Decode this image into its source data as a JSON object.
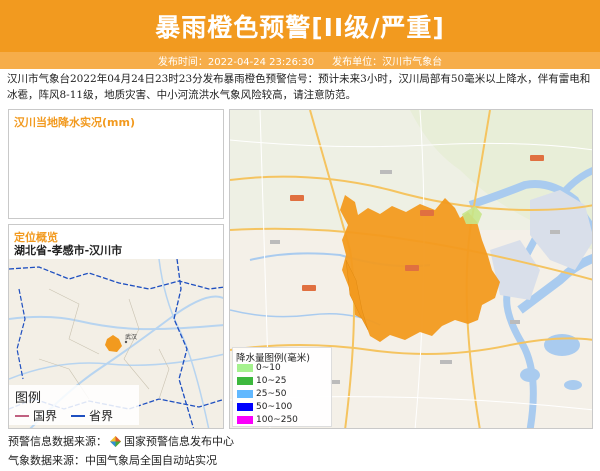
{
  "header": {
    "title": "暴雨橙色预警[II级/严重]",
    "publish_time_label": "发布时间：2022-04-24 23:26:30",
    "publisher_label": "发布单位：汉川市气象台"
  },
  "description": "汉川市气象台2022年04月24日23时23分发布暴雨橙色预警信号：预计未来3小时，汉川局部有50毫米以上降水，伴有雷电和冰雹，阵风8-11级，地质灾害、中小河流洪水气象风险较高，请注意防范。",
  "rain_panel": {
    "title": "汉川当地降水实况(mm)"
  },
  "location_panel": {
    "title": "定位概览",
    "subtitle": "湖北省-孝感市-汉川市",
    "city_label": "武汉",
    "legend": {
      "title": "图例",
      "items": [
        {
          "label": "国界",
          "color": "#c06080"
        },
        {
          "label": "省界",
          "color": "#1e4fc0"
        }
      ]
    }
  },
  "main_map": {
    "warning_area_color": "#f29a1f",
    "legend": {
      "title": "降水量图例(毫米)",
      "items": [
        {
          "label": "0~10",
          "color": "#a6f28f"
        },
        {
          "label": "10~25",
          "color": "#3db83d"
        },
        {
          "label": "25~50",
          "color": "#61b8ff"
        },
        {
          "label": "50~100",
          "color": "#0000fe"
        },
        {
          "label": "100~250",
          "color": "#fa00fa"
        }
      ]
    }
  },
  "footer": {
    "warning_source": "预警信息数据来源：",
    "warning_source_name": "国家预警信息发布中心",
    "weather_source": "气象数据来源：中国气象局全国自动站实况"
  },
  "colors": {
    "accent": "#f29a1f",
    "accent_light": "#f6ad4a"
  }
}
